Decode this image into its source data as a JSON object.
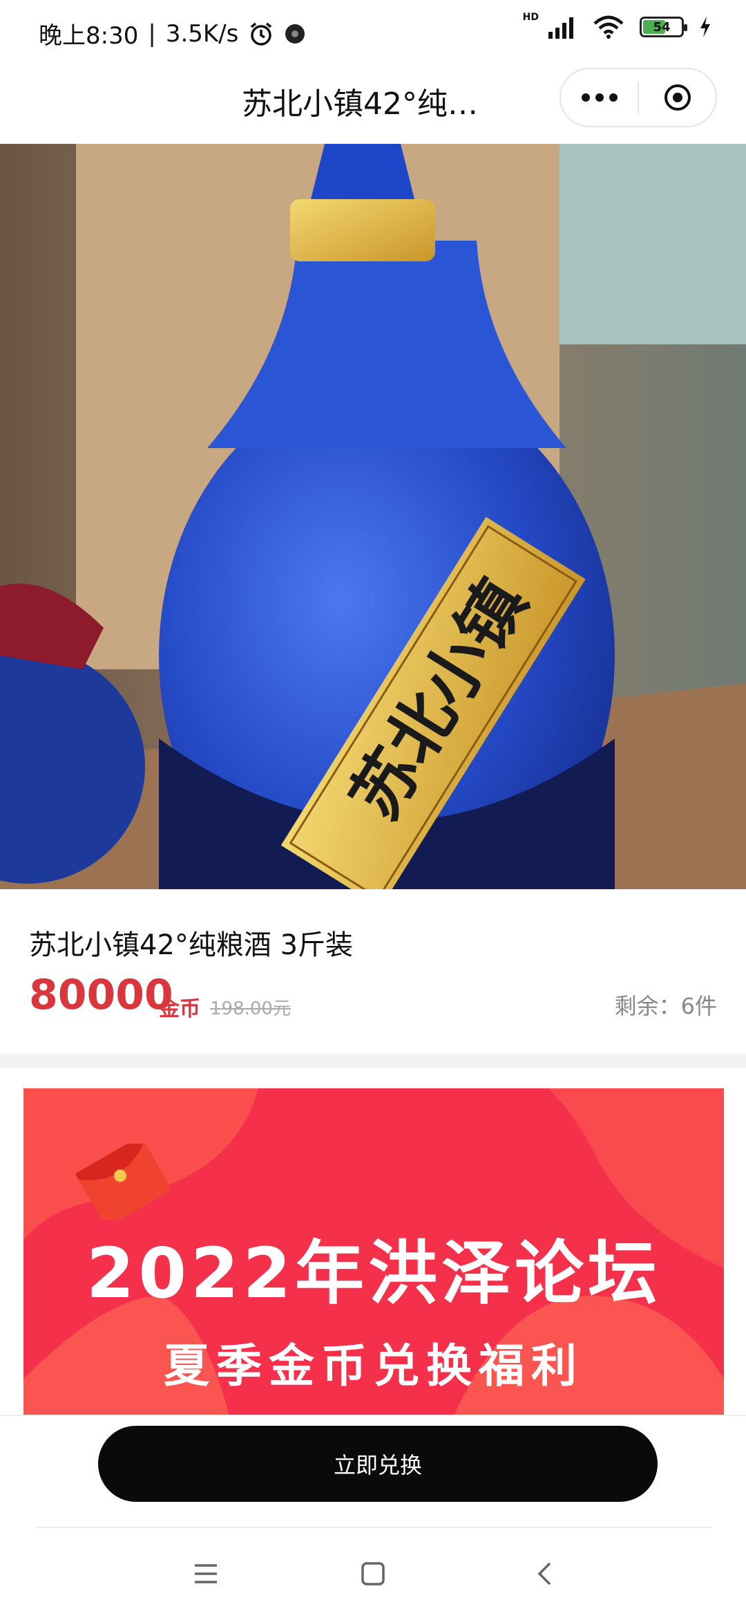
{
  "status_bar": {
    "time": "晚上8:30",
    "separator": "|",
    "net_speed": "3.5K/s",
    "hd_label": "HD",
    "battery_level": "54",
    "icons": [
      "alarm-icon",
      "notification-dot-icon",
      "signal-icon",
      "wifi-icon",
      "battery-icon",
      "charging-icon"
    ]
  },
  "nav": {
    "title": "苏北小镇42°纯…",
    "capsule_icons": [
      "more-dots-icon",
      "close-target-icon"
    ]
  },
  "product": {
    "label_text": "苏北小镇",
    "title": "苏北小镇42°纯粮酒 3斤装",
    "price": "80000",
    "price_unit": "金币",
    "original_price": "198.00元",
    "stock_label": "剩余：",
    "stock_value": "6件"
  },
  "banner": {
    "title": "2022年洪泽论坛",
    "subtitle": "夏季金币兑换福利"
  },
  "action": {
    "button_label": "立即兑换"
  },
  "system_nav": {
    "icons": [
      "menu-icon",
      "home-icon",
      "back-icon"
    ]
  },
  "colors": {
    "price": "#d9363e",
    "banner_bg": "#f5304b",
    "button_bg": "#0a0a0a",
    "bottle_blue": "#2448c4"
  }
}
